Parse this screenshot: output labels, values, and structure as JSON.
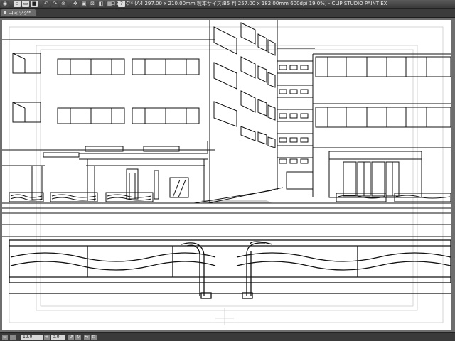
{
  "window": {
    "title": "コミック* (A4 297.00 x 210.00mm 製本サイズ:B5 判 257.00 x 182.00mm 600dpi 19.0%) - CLIP STUDIO PAINT EX"
  },
  "toolbar": {
    "icons": [
      "eye-icon",
      "new-icon",
      "open-icon",
      "save-icon",
      "undo-icon",
      "redo-icon",
      "clear-icon",
      "transform-icon",
      "select-icon",
      "deselect-icon",
      "invert-icon",
      "fill-icon",
      "help-icon"
    ]
  },
  "tabs": [
    {
      "label": "コミック*"
    }
  ],
  "statusbar": {
    "zoom": "19.0",
    "angle": "0.0"
  }
}
